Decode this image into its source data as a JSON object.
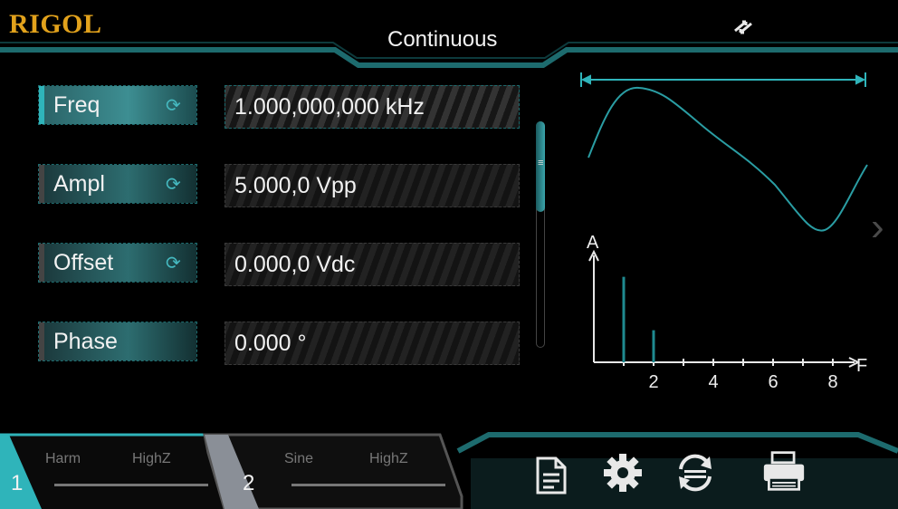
{
  "brand": {
    "logo": "RIGOL"
  },
  "header": {
    "mode": "Continuous"
  },
  "params": [
    {
      "label": "Freq",
      "value": "1.000,000,000 kHz",
      "has_toggle": true,
      "active": true
    },
    {
      "label": "Ampl",
      "value": "5.000,0 Vpp",
      "has_toggle": true,
      "active": false
    },
    {
      "label": "Offset",
      "value": "0.000,0 Vdc",
      "has_toggle": true,
      "active": false
    },
    {
      "label": "Phase",
      "value": "0.000 °",
      "has_toggle": false,
      "active": false
    }
  ],
  "spectrum": {
    "y_label": "A",
    "x_label": "F",
    "ticks": [
      "2",
      "4",
      "6",
      "8"
    ],
    "harmonics": [
      {
        "n": 1,
        "level": 0.8
      },
      {
        "n": 2,
        "level": 0.3
      }
    ]
  },
  "channels": [
    {
      "number": "1",
      "waveform": "Harm",
      "impedance": "HighZ",
      "active": true
    },
    {
      "number": "2",
      "waveform": "Sine",
      "impedance": "HighZ",
      "active": false
    }
  ],
  "toolbar": {
    "icons": [
      "document-icon",
      "gear-icon",
      "utility-sync-icon",
      "print-icon"
    ]
  },
  "colors": {
    "accent": "#2fb4ba",
    "frame": "#1d6b6e",
    "logo": "#e2a21c",
    "background": "#000000"
  }
}
